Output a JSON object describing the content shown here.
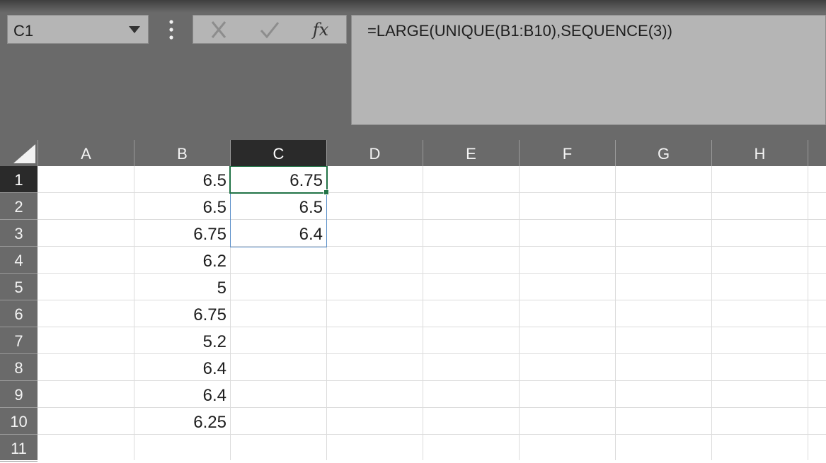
{
  "name_box": {
    "value": "C1"
  },
  "formula_bar": {
    "cancel_icon": "x-icon",
    "enter_icon": "check-icon",
    "function_label": "fx",
    "formula": "=LARGE(UNIQUE(B1:B10),SEQUENCE(3))"
  },
  "columns": [
    "A",
    "B",
    "C",
    "D",
    "E",
    "F",
    "G",
    "H"
  ],
  "selected_column": "C",
  "rows": [
    "1",
    "2",
    "3",
    "4",
    "5",
    "6",
    "7",
    "8",
    "9",
    "10",
    "11"
  ],
  "selected_row": "1",
  "cells": {
    "B": [
      "6.5",
      "6.5",
      "6.75",
      "6.2",
      "5",
      "6.75",
      "5.2",
      "6.4",
      "6.4",
      "6.25"
    ],
    "C": [
      "6.75",
      "6.5",
      "6.4"
    ]
  },
  "colors": {
    "header_bg": "#6a6a6a",
    "selected_header_bg": "#2a2a2a",
    "active_cell_border": "#217346",
    "spill_border": "#5b8fc9"
  }
}
